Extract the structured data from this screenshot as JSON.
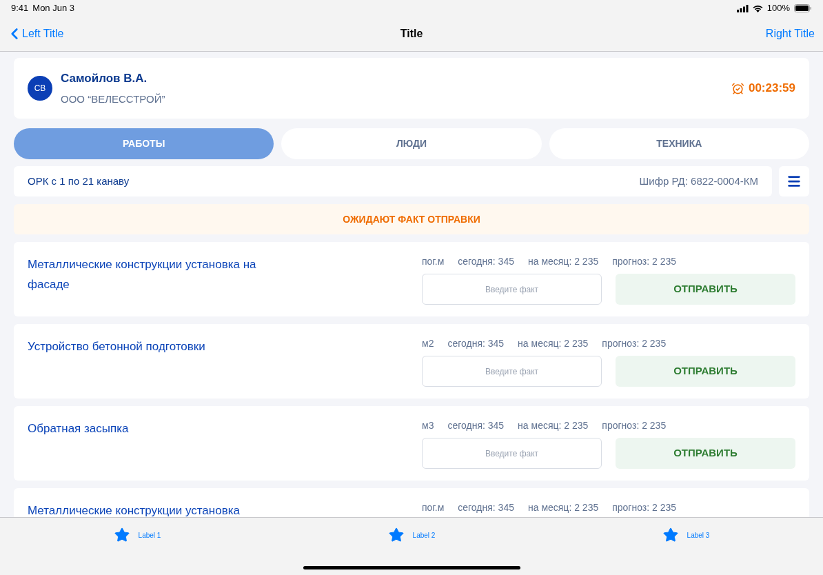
{
  "status_bar": {
    "time": "9:41",
    "date": "Mon Jun 3",
    "battery": "100%"
  },
  "nav_bar": {
    "left": "Left Title",
    "title": "Title",
    "right": "Right Title"
  },
  "header": {
    "initials": "СВ",
    "name": "Самойлов В.А.",
    "company": "ООО “ВЕЛЕССТРОЙ”",
    "timer": "00:23:59"
  },
  "tabs": [
    {
      "label": "РАБОТЫ",
      "selected": true
    },
    {
      "label": "ЛЮДИ",
      "selected": false
    },
    {
      "label": "ТЕХНИКА",
      "selected": false
    }
  ],
  "object": {
    "name": "ОРК с 1 по 21 канаву",
    "code": "Шифр РД: 6822-0004-КМ"
  },
  "banner": "ОЖИДАЮТ ФАКТ ОТПРАВКИ",
  "works": [
    {
      "title": "Металлические конструкции установка на фасаде",
      "unit": "пог.м",
      "today": "сегодня: 345",
      "month": "на месяц: 2 235",
      "forecast": "прогноз: 2 235",
      "placeholder": "Введите факт",
      "button": "ОТПРАВИТЬ"
    },
    {
      "title": "Устройство бетонной подготовки",
      "unit": "м2",
      "today": "сегодня: 345",
      "month": "на месяц: 2 235",
      "forecast": "прогноз: 2 235",
      "placeholder": "Введите факт",
      "button": "ОТПРАВИТЬ"
    },
    {
      "title": "Обратная засыпка",
      "unit": "м3",
      "today": "сегодня: 345",
      "month": "на месяц: 2 235",
      "forecast": "прогноз: 2 235",
      "placeholder": "Введите факт",
      "button": "ОТПРАВИТЬ"
    },
    {
      "title": "Металлические конструкции установка",
      "unit": "пог.м",
      "today": "сегодня: 345",
      "month": "на месяц: 2 235",
      "forecast": "прогноз: 2 235"
    }
  ],
  "tab_bar": [
    {
      "label": "Label 1"
    },
    {
      "label": "Label 2"
    },
    {
      "label": "Label 3"
    }
  ]
}
